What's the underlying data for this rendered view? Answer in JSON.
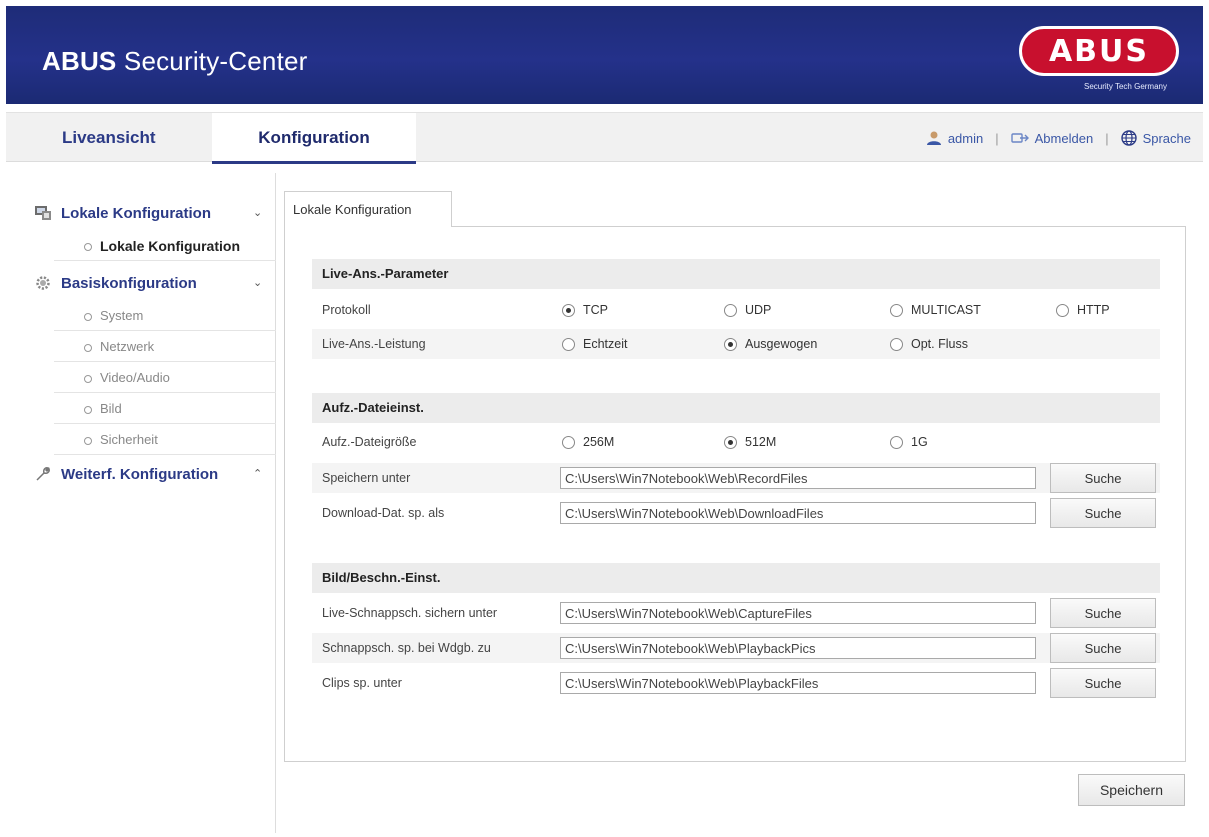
{
  "header": {
    "title_bold": "ABUS",
    "title_rest": " Security-Center",
    "logo_text": "ABUS",
    "logo_tagline": "Security Tech Germany"
  },
  "nav": {
    "tabs": [
      {
        "label": "Liveansicht",
        "active": false
      },
      {
        "label": "Konfiguration",
        "active": true
      }
    ],
    "user": "admin",
    "logout": "Abmelden",
    "language": "Sprache",
    "separator": "|"
  },
  "sidebar": {
    "groups": [
      {
        "label": "Lokale Konfiguration",
        "icon": "monitor-icon",
        "expanded": true,
        "items": [
          {
            "label": "Lokale Konfiguration",
            "active": true
          }
        ]
      },
      {
        "label": "Basiskonfiguration",
        "icon": "gear-icon",
        "expanded": true,
        "items": [
          {
            "label": "System"
          },
          {
            "label": "Netzwerk"
          },
          {
            "label": "Video/Audio"
          },
          {
            "label": "Bild"
          },
          {
            "label": "Sicherheit"
          }
        ]
      },
      {
        "label": "Weiterf. Konfiguration",
        "icon": "wrench-icon",
        "expanded": false,
        "items": []
      }
    ]
  },
  "content": {
    "tab_label": "Lokale Konfiguration",
    "live_section": {
      "title": "Live-Ans.-Parameter",
      "protocol": {
        "label": "Protokoll",
        "options": [
          "TCP",
          "UDP",
          "MULTICAST",
          "HTTP"
        ],
        "selected": "TCP"
      },
      "performance": {
        "label": "Live-Ans.-Leistung",
        "options": [
          "Echtzeit",
          "Ausgewogen",
          "Opt. Fluss"
        ],
        "selected": "Ausgewogen"
      }
    },
    "record_section": {
      "title": "Aufz.-Dateieinst.",
      "filesize": {
        "label": "Aufz.-Dateigröße",
        "options": [
          "256M",
          "512M",
          "1G"
        ],
        "selected": "512M"
      },
      "save_to": {
        "label": "Speichern unter",
        "value": "C:\\Users\\Win7Notebook\\Web\\RecordFiles",
        "button": "Suche"
      },
      "download_to": {
        "label": "Download-Dat. sp. als",
        "value": "C:\\Users\\Win7Notebook\\Web\\DownloadFiles",
        "button": "Suche"
      }
    },
    "image_section": {
      "title": "Bild/Beschn.-Einst.",
      "live_snapshot": {
        "label": "Live-Schnappsch. sichern unter",
        "value": "C:\\Users\\Win7Notebook\\Web\\CaptureFiles",
        "button": "Suche"
      },
      "playback_snapshot": {
        "label": "Schnappsch. sp. bei Wdgb. zu",
        "value": "C:\\Users\\Win7Notebook\\Web\\PlaybackPics",
        "button": "Suche"
      },
      "clips": {
        "label": "Clips sp. unter",
        "value": "C:\\Users\\Win7Notebook\\Web\\PlaybackFiles",
        "button": "Suche"
      }
    },
    "save_button": "Speichern"
  },
  "colors": {
    "header_bg": "#24318a",
    "accent": "#2b3a86",
    "logo_red": "#c8102e"
  }
}
